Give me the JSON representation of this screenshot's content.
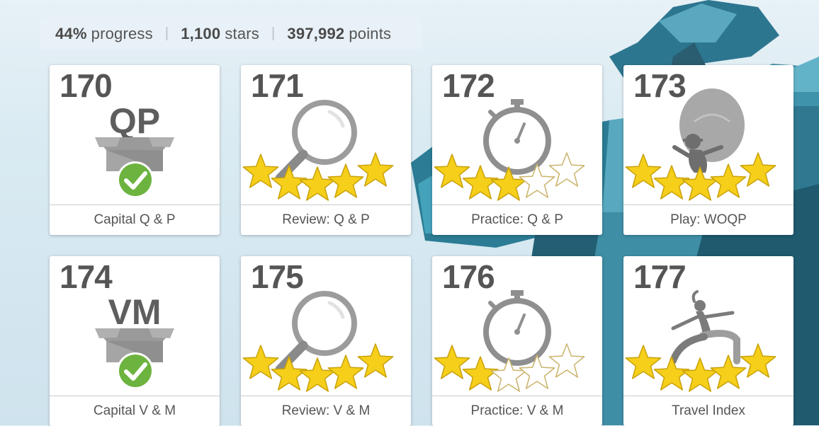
{
  "stats": {
    "progress_value": "44%",
    "progress_label": "progress",
    "stars_value": "1,100",
    "stars_label": "stars",
    "points_value": "397,992",
    "points_label": "points",
    "separator": "|"
  },
  "colors": {
    "star_fill": "#f5cf1a",
    "star_empty": "#ffffff",
    "icon_gray": "#8f8f8f",
    "check_green": "#6db33f"
  },
  "lessons": [
    {
      "number": "170",
      "title": "Capital Q & P",
      "kind": "capital",
      "letters": "QP",
      "completed": true,
      "icon": "open-box-icon"
    },
    {
      "number": "171",
      "title": "Review: Q & P",
      "kind": "review",
      "stars": 5,
      "icon": "magnifier-icon"
    },
    {
      "number": "172",
      "title": "Practice: Q & P",
      "kind": "practice",
      "stars": 3,
      "icon": "stopwatch-icon"
    },
    {
      "number": "173",
      "title": "Play: WOQP",
      "kind": "play",
      "stars": 5,
      "icon": "hot-air-balloon-icon"
    },
    {
      "number": "174",
      "title": "Capital V & M",
      "kind": "capital",
      "letters": "VM",
      "completed": true,
      "icon": "open-box-icon"
    },
    {
      "number": "175",
      "title": "Review: V & M",
      "kind": "review",
      "stars": 5,
      "icon": "magnifier-icon"
    },
    {
      "number": "176",
      "title": "Practice: V & M",
      "kind": "practice",
      "stars": 2,
      "icon": "stopwatch-icon"
    },
    {
      "number": "177",
      "title": "Travel Index",
      "kind": "travel",
      "stars": 5,
      "icon": "running-person-icon"
    }
  ]
}
